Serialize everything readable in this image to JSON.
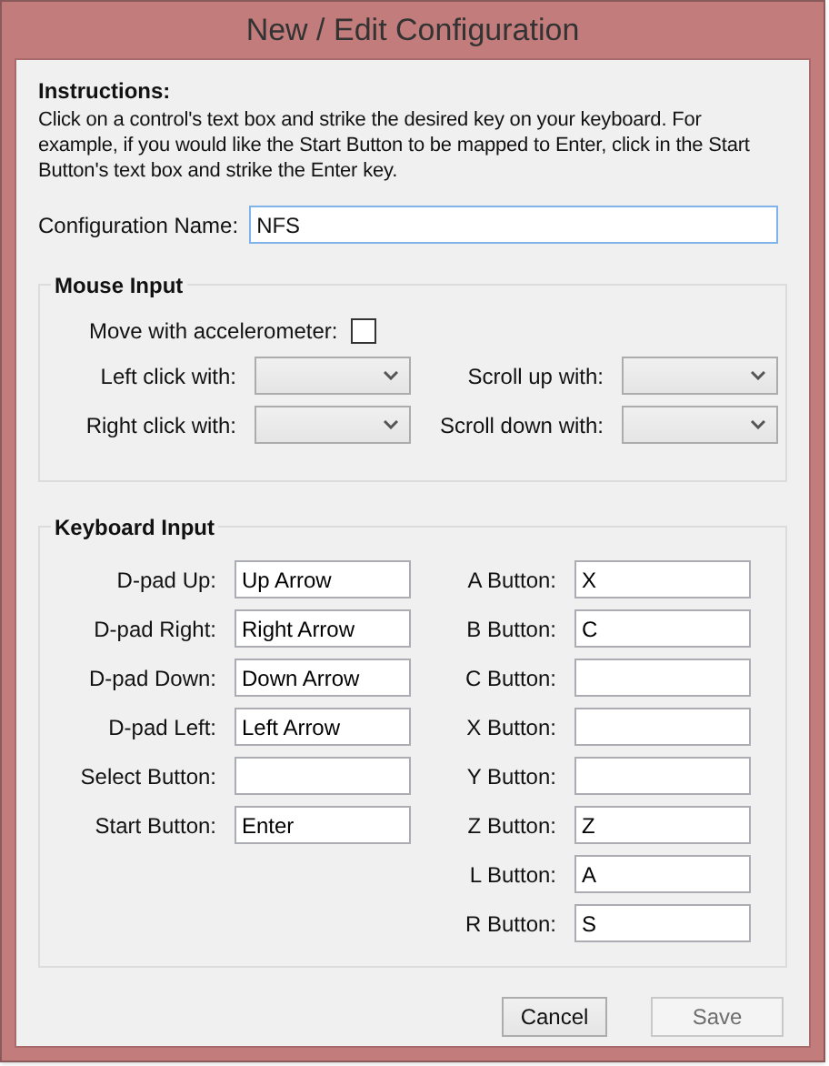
{
  "window": {
    "title": "New / Edit Configuration"
  },
  "instructions": {
    "heading": "Instructions:",
    "text": "Click on a control's text box and strike the desired key on your keyboard. For example, if you would like the Start Button to be mapped to Enter, click in the Start Button's text box and strike the Enter key."
  },
  "configuration_name": {
    "label": "Configuration Name:",
    "value": "NFS"
  },
  "mouse_input": {
    "title": "Mouse Input",
    "accelerometer": {
      "label": "Move with accelerometer:",
      "checked": false
    },
    "dropdowns": [
      {
        "label": "Left click with:"
      },
      {
        "label": "Scroll up with:"
      },
      {
        "label": "Right click with:"
      },
      {
        "label": "Scroll down with:"
      }
    ]
  },
  "keyboard_input": {
    "title": "Keyboard Input",
    "left": [
      {
        "label": "D-pad Up:",
        "value": "Up Arrow"
      },
      {
        "label": "D-pad Right:",
        "value": "Right Arrow"
      },
      {
        "label": "D-pad Down:",
        "value": "Down Arrow"
      },
      {
        "label": "D-pad Left:",
        "value": "Left Arrow"
      },
      {
        "label": "Select Button:"
      },
      {
        "label": "Start Button:",
        "value": "Enter"
      }
    ],
    "right": [
      {
        "label": "A Button:",
        "value": "X"
      },
      {
        "label": "B Button:",
        "value": "C"
      },
      {
        "label": "C Button:"
      },
      {
        "label": "X Button:"
      },
      {
        "label": "Y Button:"
      },
      {
        "label": "Z Button:",
        "value": "Z"
      },
      {
        "label": "L Button:",
        "value": "A"
      },
      {
        "label": "R Button:",
        "value": "S"
      }
    ]
  },
  "buttons": [
    {
      "label": "Cancel",
      "disabled": false
    },
    {
      "label": "Save",
      "disabled": true
    }
  ]
}
